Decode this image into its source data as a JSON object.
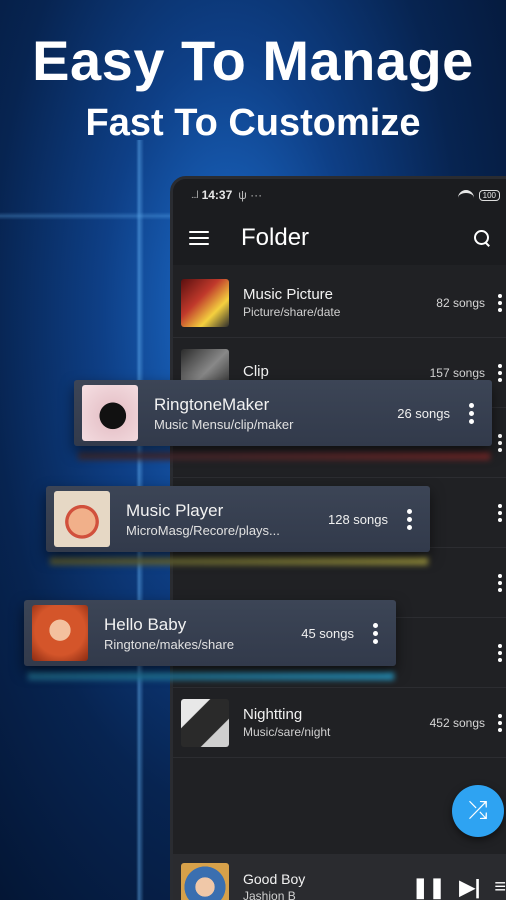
{
  "headline": {
    "line1": "Easy To Manage",
    "line2": "Fast To Customize"
  },
  "status_bar": {
    "signal": "...l",
    "time": "14:37",
    "extra": "ψ ···",
    "battery": "100"
  },
  "app_bar": {
    "title": "Folder"
  },
  "folders": [
    {
      "name": "Music Picture",
      "path": "Picture/share/date",
      "count": "82 songs"
    },
    {
      "name": "Clip",
      "path": "",
      "count": "157 songs"
    },
    {
      "name": "Nightting",
      "path": "Music/sare/night",
      "count": "452 songs"
    }
  ],
  "cards": [
    {
      "name": "RingtoneMaker",
      "path": "Music Mensu/clip/maker",
      "count": "26 songs"
    },
    {
      "name": "Music Player",
      "path": "MicroMasg/Recore/plays...",
      "count": "128 songs"
    },
    {
      "name": "Hello Baby",
      "path": "Ringtone/makes/share",
      "count": "45 songs"
    }
  ],
  "now_playing": {
    "title": "Good Boy",
    "artist": "Jashion B"
  },
  "icons": {
    "fab": "shuffle-icon",
    "pause": "pause-icon",
    "next": "skip-next-icon",
    "queue": "queue-icon"
  },
  "colors": {
    "accent": "#2ea3f2",
    "background": "#0e3f86",
    "list_bg": "#202124"
  }
}
